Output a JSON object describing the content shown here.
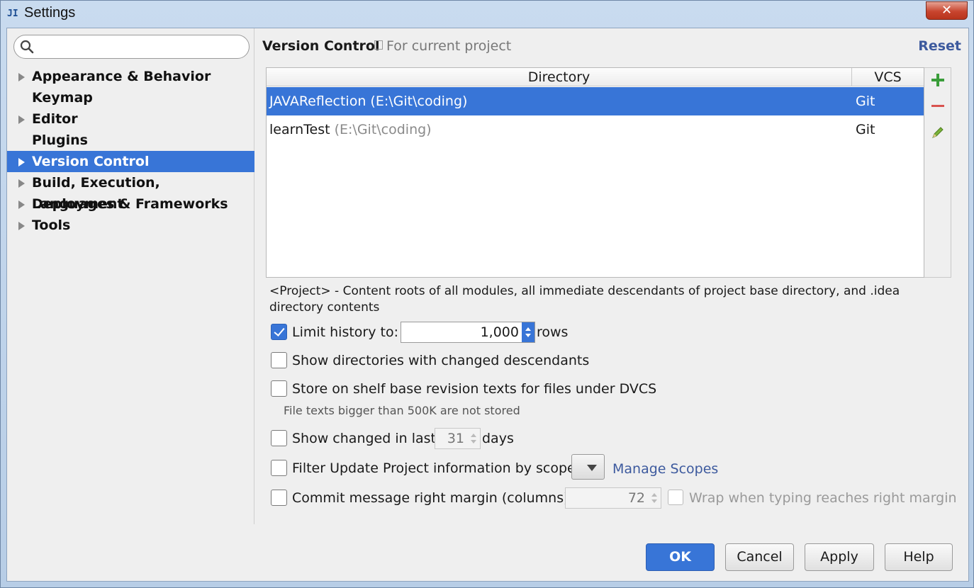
{
  "window": {
    "title": "Settings",
    "app_icon": "JI",
    "close_glyph": "✕"
  },
  "sidebar": {
    "search": {
      "placeholder": "",
      "value": ""
    },
    "items": [
      {
        "label": "Appearance & Behavior",
        "expandable": true
      },
      {
        "label": "Keymap",
        "expandable": false
      },
      {
        "label": "Editor",
        "expandable": true
      },
      {
        "label": "Plugins",
        "expandable": false
      },
      {
        "label": "Version Control",
        "expandable": true,
        "selected": true
      },
      {
        "label": "Build, Execution, Deployment",
        "expandable": true
      },
      {
        "label": "Languages & Frameworks",
        "expandable": true
      },
      {
        "label": "Tools",
        "expandable": true
      }
    ]
  },
  "header": {
    "title": "Version Control",
    "subtitle": "For current project",
    "reset": "Reset"
  },
  "table": {
    "columns": [
      "Directory",
      "VCS"
    ],
    "rows": [
      {
        "name": "JAVAReflection",
        "path": "(E:\\Git\\coding)",
        "vcs": "Git",
        "selected": true
      },
      {
        "name": "learnTest",
        "path": "(E:\\Git\\coding)",
        "vcs": "Git",
        "selected": false
      }
    ],
    "tools": [
      "add-icon",
      "remove-icon",
      "edit-icon"
    ]
  },
  "note": "<Project> - Content roots of all modules, all immediate descendants of project base directory, and .idea directory contents",
  "options": {
    "limit_history": {
      "label": "Limit history to:",
      "checked": true,
      "value": "1,000",
      "suffix": "rows"
    },
    "show_dirs": {
      "label": "Show directories with changed descendants",
      "checked": false
    },
    "store_shelf": {
      "label": "Store on shelf base revision texts for files under DVCS",
      "checked": false,
      "hint": "File texts bigger than 500K are not stored"
    },
    "show_changed": {
      "label": "Show changed in last",
      "checked": false,
      "value": "31",
      "suffix": "days"
    },
    "filter_update": {
      "label": "Filter Update Project information by scope",
      "checked": false,
      "manage": "Manage Scopes"
    },
    "commit_margin": {
      "label": "Commit message right margin (columns):",
      "checked": false,
      "value": "72",
      "wrap_label": "Wrap when typing reaches right margin"
    }
  },
  "buttons": {
    "ok": "OK",
    "cancel": "Cancel",
    "apply": "Apply",
    "help": "Help"
  },
  "colors": {
    "accent": "#3875d7",
    "link": "#3d5a9e",
    "add": "#3a9d3a",
    "remove": "#d9534f"
  }
}
